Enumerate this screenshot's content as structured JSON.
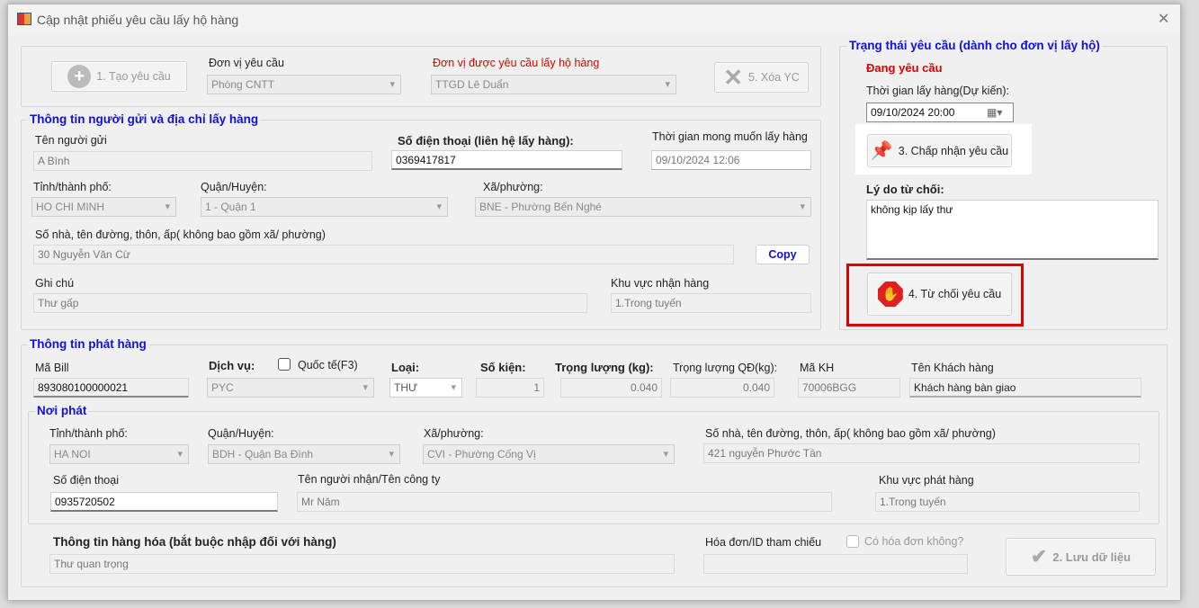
{
  "window": {
    "title": "Cập nhật phiếu yêu cầu lấy hộ hàng",
    "close": "✕"
  },
  "top": {
    "create_button": "1. Tạo yêu cầu",
    "requesting_unit_label": "Đơn vị yêu cầu",
    "requesting_unit_value": "Phòng CNTT",
    "target_unit_label": "Đơn vị được yêu cầu lấy hộ hàng",
    "target_unit_value": "TTGD Lê Duẩn",
    "delete_button": "5. Xóa YC"
  },
  "sender": {
    "title": "Thông tin người gửi và địa chỉ lấy hàng",
    "name_label": "Tên người gửi",
    "name_value": "A Bình",
    "phone_label": "Số điện thoại (liên hệ lấy hàng):",
    "phone_value": "0369417817",
    "desired_time_label": "Thời gian mong muốn lấy hàng",
    "desired_time_value": "09/10/2024 12:06",
    "province_label": "Tỉnh/thành phố:",
    "province_value": "HO CHI MINH",
    "district_label": "Quận/Huyện:",
    "district_value": "1 - Quận 1",
    "ward_label": "Xã/phường:",
    "ward_value": "BNE - Phường Bến Nghé",
    "address_label": "Số nhà, tên đường, thôn, ấp( không bao gồm xã/ phường)",
    "address_value": "30 Nguyễn Văn Cừ",
    "copy_button": "Copy",
    "note_label": "Ghi chú",
    "note_value": "Thư gấp",
    "area_label": "Khu vực nhận hàng",
    "area_value": "1.Trong tuyến"
  },
  "status": {
    "title": "Trạng thái yêu cầu (dành cho đơn vị lấy hộ)",
    "state": "Đang yêu cầu",
    "pickup_time_label": "Thời gian lấy hàng(Dự kiến):",
    "pickup_time_value": "09/10/2024 20:00",
    "accept_button": "3. Chấp nhận yêu cầu",
    "reject_reason_label": "Lý do từ chối:",
    "reject_reason_value": "không kịp lấy thư",
    "reject_button": "4. Từ chối yêu cầu",
    "highlight_color": "#e00000"
  },
  "shipment": {
    "title": "Thông tin phát hàng",
    "bill_label": "Mã Bill",
    "bill_value": "893080100000021",
    "service_label": "Dịch vụ:",
    "intl_label": "Quốc tế(F3)",
    "intl_checked": false,
    "service_value": "PYC",
    "type_label": "Loại:",
    "type_value": "THƯ",
    "count_label": "Số kiện:",
    "count_value": "1",
    "weight_label": "Trọng lượng (kg):",
    "weight_value": "0.040",
    "qd_weight_label": "Trọng lượng QĐ(kg):",
    "qd_weight_value": "0.040",
    "customer_code_label": "Mã KH",
    "customer_code_value": "70006BGG",
    "customer_name_label": "Tên Khách hàng",
    "customer_name_value": "Khách hàng bàn giao"
  },
  "origin": {
    "title": "Nơi phát",
    "province_label": "Tỉnh/thành phố:",
    "province_value": "HA NOI",
    "district_label": "Quận/Huyện:",
    "district_value": "BDH - Quận Ba Đình",
    "ward_label": "Xã/phường:",
    "ward_value": "CVI - Phường Cống Vị",
    "address_label": "Số nhà, tên đường, thôn, ấp( không bao gồm xã/ phường)",
    "address_value": "421 nguyễn Phước Tần",
    "phone_label": "Số điện thoại",
    "phone_value": "0935720502",
    "receiver_label": "Tên người nhận/Tên công ty",
    "receiver_value": "Mr Năm",
    "area_label": "Khu vực phát hàng",
    "area_value": "1.Trong tuyến"
  },
  "goods": {
    "label": "Thông tin hàng hóa (bắt buộc nhập đối với hàng)",
    "value": "Thư quan trọng",
    "invoice_label": "Hóa đơn/ID tham chiếu",
    "invoice_value": "",
    "has_invoice_label": "Có hóa đơn không?",
    "has_invoice_checked": false,
    "save_button": "2. Lưu dữ liệu"
  }
}
